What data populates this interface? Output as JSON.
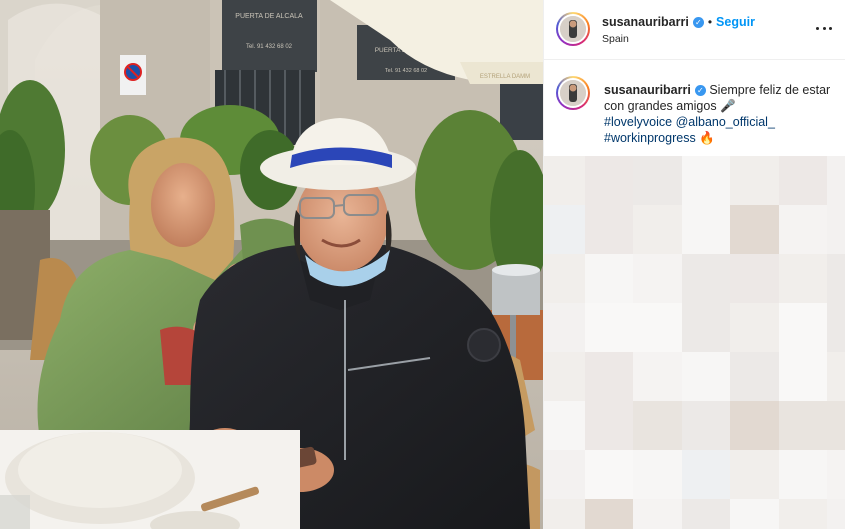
{
  "post": {
    "username": "susanauribarri",
    "verified_icon": "check",
    "separator": "•",
    "follow_label": "Seguir",
    "location": "Spain",
    "more_icon": "more-horizontal-icon"
  },
  "caption": {
    "username": "susanauribarri",
    "text": "Siempre feliz de estar con grandes amigos",
    "emoji_mic": "🎤",
    "hashtag_1": "#lovelyvoice",
    "mention": "@albano_official_",
    "hashtag_2": "#workinprogress",
    "emoji_fire": "🔥"
  },
  "photo": {
    "sign_1_line1": "PUERTA DE ALCALA",
    "sign_1_line2": "Tel. 91 432 68 02",
    "sign_2_line1": "PUERTA DE ALCALA",
    "sign_2_line2": "Tel. 91 432 68 02",
    "umbrella_text": "ESTRELLA DAMM"
  },
  "colors": {
    "link": "#0095f6",
    "hashtag": "#00376b",
    "verified": "#3897f0",
    "text": "#262626"
  }
}
